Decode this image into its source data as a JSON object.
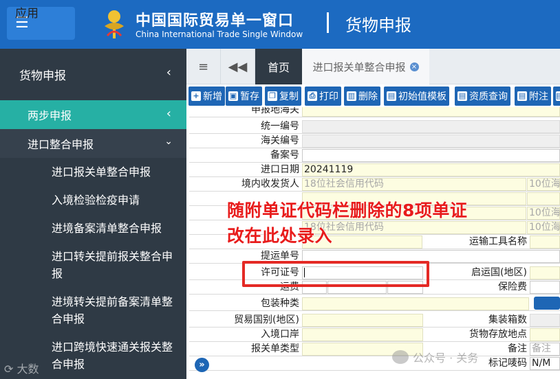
{
  "header": {
    "menu_label": "应用",
    "title_cn": "中国国际贸易单一窗口",
    "title_en": "China International Trade Single Window",
    "module": "货物申报"
  },
  "sidebar": {
    "top": "货物申报",
    "active": "两步申报",
    "group": "进口整合申报",
    "items": [
      "进口报关单整合申报",
      "入境检验检疫申请",
      "进境备案清单整合申报",
      "进口转关提前报关整合申报",
      "进境转关提前备案清单整合申报",
      "进口跨境快速通关报关整合申报"
    ]
  },
  "tabs": {
    "home": "首页",
    "doc": "进口报关单整合申报"
  },
  "toolbar": {
    "add": "新增",
    "save": "暂存",
    "copy": "复制",
    "print": "打印",
    "delete": "删除",
    "template": "初始值模板",
    "query": "资质查询",
    "attach": "附注"
  },
  "form": {
    "declare_customs": "申报地海关",
    "unified_no": "统一编号",
    "customs_no": "海关编号",
    "record_no": "备案号",
    "import_date_label": "进口日期",
    "import_date": "20241119",
    "consignee_label": "境内收发货人",
    "credit_code_ph": "18位社会信用代码",
    "ten_digit_ph": "10位海",
    "declarant_credit_ph": "18位社会信用代码",
    "transport_name": "运输工具名称",
    "bill_no": "提运单号",
    "license_no": "许可证号",
    "departure_country": "启运国(地区)",
    "freight": "运费",
    "insurance": "保险费",
    "pack_type": "包装种类",
    "trade_country": "贸易国别(地区)",
    "container_count": "集装箱数",
    "entry_port": "入境口岸",
    "storage_place": "货物存放地点",
    "decl_type": "报关单类型",
    "remark_label": "备注",
    "remark_ph": "备注",
    "marks_label": "标记唛码",
    "marks_value": "N/M"
  },
  "annotation": {
    "line1": "随附单证代码栏删除的8项单证",
    "line2": "改在此处录入"
  },
  "watermark": {
    "left": "大数",
    "right": "公众号 · 关务"
  }
}
